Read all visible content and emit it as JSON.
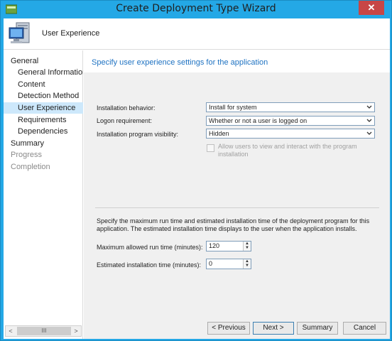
{
  "window": {
    "title": "Create Deployment Type Wizard",
    "close_glyph": "✕",
    "app_icon": "wizard-icon"
  },
  "header": {
    "title": "User Experience",
    "icon": "computer-icon"
  },
  "sidebar": {
    "items": [
      {
        "label": "General",
        "level": 0,
        "state": "normal"
      },
      {
        "label": "General Information",
        "level": 1,
        "state": "normal"
      },
      {
        "label": "Content",
        "level": 1,
        "state": "normal"
      },
      {
        "label": "Detection Method",
        "level": 1,
        "state": "normal"
      },
      {
        "label": "User Experience",
        "level": 1,
        "state": "selected"
      },
      {
        "label": "Requirements",
        "level": 1,
        "state": "normal"
      },
      {
        "label": "Dependencies",
        "level": 1,
        "state": "normal"
      },
      {
        "label": "Summary",
        "level": 0,
        "state": "normal"
      },
      {
        "label": "Progress",
        "level": 0,
        "state": "disabled"
      },
      {
        "label": "Completion",
        "level": 0,
        "state": "disabled"
      }
    ],
    "scroll_left": "<",
    "scroll_thumb": "III",
    "scroll_right": ">"
  },
  "main": {
    "heading": "Specify user experience settings for the application",
    "installation_behavior": {
      "label": "Installation behavior:",
      "value": "Install for system"
    },
    "logon_requirement": {
      "label": "Logon requirement:",
      "value": "Whether or not a user is logged on"
    },
    "program_visibility": {
      "label": "Installation program visibility:",
      "value": "Hidden"
    },
    "allow_interact": {
      "label": "Allow users to view and interact with the program installation",
      "checked": false,
      "enabled": false
    },
    "description": "Specify the maximum run time and estimated installation time of the deployment program for this application. The estimated installation time displays to the user when the application installs.",
    "max_run_time": {
      "label": "Maximum allowed run time (minutes):",
      "value": "120"
    },
    "est_install_time": {
      "label": "Estimated installation time (minutes):",
      "value": "0"
    }
  },
  "footer": {
    "previous": "< Previous",
    "next": "Next >",
    "summary": "Summary",
    "cancel": "Cancel"
  },
  "colors": {
    "titlebar": "#24a8e6",
    "heading": "#1e72c2",
    "selected_nav": "#cde8fb"
  }
}
